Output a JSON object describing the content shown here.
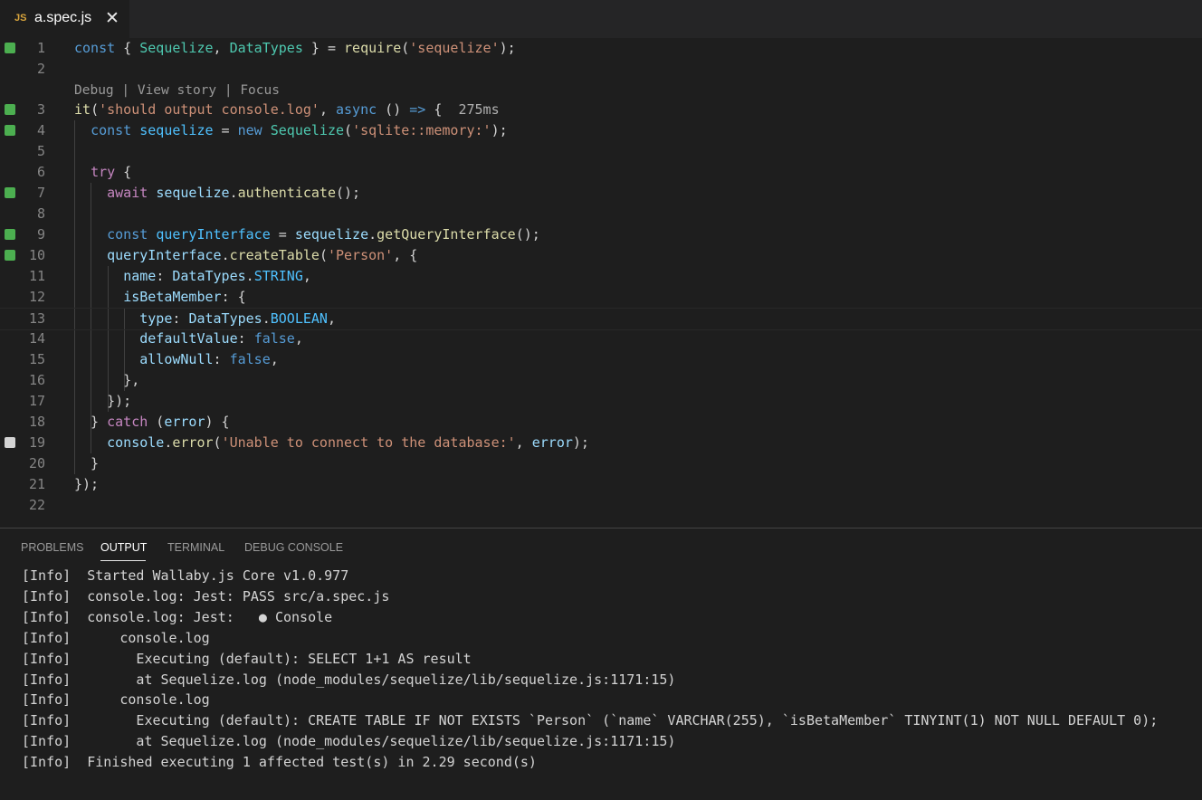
{
  "tab": {
    "icon": "JS",
    "filename": "a.spec.js",
    "close": "✕"
  },
  "codelens": "Debug | View story | Focus",
  "lines": [
    {
      "n": "1",
      "mark": "green"
    },
    {
      "n": "2",
      "mark": ""
    },
    {
      "n": "3",
      "mark": "green"
    },
    {
      "n": "4",
      "mark": "green"
    },
    {
      "n": "5",
      "mark": ""
    },
    {
      "n": "6",
      "mark": ""
    },
    {
      "n": "7",
      "mark": "green"
    },
    {
      "n": "8",
      "mark": ""
    },
    {
      "n": "9",
      "mark": "green"
    },
    {
      "n": "10",
      "mark": "green"
    },
    {
      "n": "11",
      "mark": ""
    },
    {
      "n": "12",
      "mark": ""
    },
    {
      "n": "13",
      "mark": ""
    },
    {
      "n": "14",
      "mark": ""
    },
    {
      "n": "15",
      "mark": ""
    },
    {
      "n": "16",
      "mark": ""
    },
    {
      "n": "17",
      "mark": ""
    },
    {
      "n": "18",
      "mark": ""
    },
    {
      "n": "19",
      "mark": "white"
    },
    {
      "n": "20",
      "mark": ""
    },
    {
      "n": "21",
      "mark": ""
    },
    {
      "n": "22",
      "mark": ""
    }
  ],
  "code": [
    [
      [
        "k",
        "const"
      ],
      [
        "p",
        " { "
      ],
      [
        "t",
        "Sequelize"
      ],
      [
        "p",
        ", "
      ],
      [
        "t",
        "DataTypes"
      ],
      [
        "p",
        " } = "
      ],
      [
        "f",
        "require"
      ],
      [
        "p",
        "("
      ],
      [
        "s",
        "'sequelize'"
      ],
      [
        "p",
        ");"
      ]
    ],
    [],
    [
      [
        "f",
        "it"
      ],
      [
        "p",
        "("
      ],
      [
        "s",
        "'should output console.log'"
      ],
      [
        "p",
        ", "
      ],
      [
        "k",
        "async"
      ],
      [
        "p",
        " () "
      ],
      [
        "k",
        "=>"
      ],
      [
        "p",
        " {  "
      ],
      [
        "time",
        "275ms"
      ]
    ],
    [
      [
        "p",
        "  "
      ],
      [
        "k",
        "const"
      ],
      [
        "p",
        " "
      ],
      [
        "n",
        "sequelize"
      ],
      [
        "p",
        " = "
      ],
      [
        "k",
        "new"
      ],
      [
        "p",
        " "
      ],
      [
        "t",
        "Sequelize"
      ],
      [
        "p",
        "("
      ],
      [
        "s",
        "'sqlite::memory:'"
      ],
      [
        "p",
        ");"
      ]
    ],
    [],
    [
      [
        "p",
        "  "
      ],
      [
        "c",
        "try"
      ],
      [
        "p",
        " {"
      ]
    ],
    [
      [
        "p",
        "    "
      ],
      [
        "c",
        "await"
      ],
      [
        "p",
        " "
      ],
      [
        "v",
        "sequelize"
      ],
      [
        "p",
        "."
      ],
      [
        "f",
        "authenticate"
      ],
      [
        "p",
        "();"
      ]
    ],
    [],
    [
      [
        "p",
        "    "
      ],
      [
        "k",
        "const"
      ],
      [
        "p",
        " "
      ],
      [
        "n",
        "queryInterface"
      ],
      [
        "p",
        " = "
      ],
      [
        "v",
        "sequelize"
      ],
      [
        "p",
        "."
      ],
      [
        "f",
        "getQueryInterface"
      ],
      [
        "p",
        "();"
      ]
    ],
    [
      [
        "p",
        "    "
      ],
      [
        "v",
        "queryInterface"
      ],
      [
        "p",
        "."
      ],
      [
        "f",
        "createTable"
      ],
      [
        "p",
        "("
      ],
      [
        "s",
        "'Person'"
      ],
      [
        "p",
        ", {"
      ]
    ],
    [
      [
        "p",
        "      "
      ],
      [
        "v",
        "name"
      ],
      [
        "p",
        ": "
      ],
      [
        "v",
        "DataTypes"
      ],
      [
        "p",
        "."
      ],
      [
        "n",
        "STRING"
      ],
      [
        "p",
        ","
      ]
    ],
    [
      [
        "p",
        "      "
      ],
      [
        "v",
        "isBetaMember"
      ],
      [
        "p",
        ": {"
      ]
    ],
    [
      [
        "p",
        "        "
      ],
      [
        "v",
        "type"
      ],
      [
        "p",
        ": "
      ],
      [
        "v",
        "DataTypes"
      ],
      [
        "p",
        "."
      ],
      [
        "n",
        "BOOLEAN"
      ],
      [
        "p",
        ","
      ]
    ],
    [
      [
        "p",
        "        "
      ],
      [
        "v",
        "defaultValue"
      ],
      [
        "p",
        ": "
      ],
      [
        "k",
        "false"
      ],
      [
        "p",
        ","
      ]
    ],
    [
      [
        "p",
        "        "
      ],
      [
        "v",
        "allowNull"
      ],
      [
        "p",
        ": "
      ],
      [
        "k",
        "false"
      ],
      [
        "p",
        ","
      ]
    ],
    [
      [
        "p",
        "      },"
      ]
    ],
    [
      [
        "p",
        "    });"
      ]
    ],
    [
      [
        "p",
        "  } "
      ],
      [
        "c",
        "catch"
      ],
      [
        "p",
        " ("
      ],
      [
        "v",
        "error"
      ],
      [
        "p",
        ") {"
      ]
    ],
    [
      [
        "p",
        "    "
      ],
      [
        "v",
        "console"
      ],
      [
        "p",
        "."
      ],
      [
        "f",
        "error"
      ],
      [
        "p",
        "("
      ],
      [
        "s",
        "'Unable to connect to the database:'"
      ],
      [
        "p",
        ", "
      ],
      [
        "v",
        "error"
      ],
      [
        "p",
        ");"
      ]
    ],
    [
      [
        "p",
        "  }"
      ]
    ],
    [
      [
        "p",
        "});"
      ]
    ],
    []
  ],
  "panel": {
    "tabs": [
      "PROBLEMS",
      "OUTPUT",
      "TERMINAL",
      "DEBUG CONSOLE"
    ],
    "active_tab": "OUTPUT",
    "output": [
      "[Info]  Started Wallaby.js Core v1.0.977",
      "[Info]  console.log: Jest: PASS src/a.spec.js",
      "[Info]  console.log: Jest:   ● Console",
      "[Info]      console.log",
      "[Info]        Executing (default): SELECT 1+1 AS result",
      "[Info]        at Sequelize.log (node_modules/sequelize/lib/sequelize.js:1171:15)",
      "[Info]      console.log",
      "[Info]        Executing (default): CREATE TABLE IF NOT EXISTS `Person` (`name` VARCHAR(255), `isBetaMember` TINYINT(1) NOT NULL DEFAULT 0);",
      "[Info]        at Sequelize.log (node_modules/sequelize/lib/sequelize.js:1171:15)",
      "[Info]  Finished executing 1 affected test(s) in 2.29 second(s)"
    ]
  },
  "colors": {
    "pass": "#4caf50",
    "uncovered": "#d4d4d4",
    "accent": "#d9a53c"
  }
}
